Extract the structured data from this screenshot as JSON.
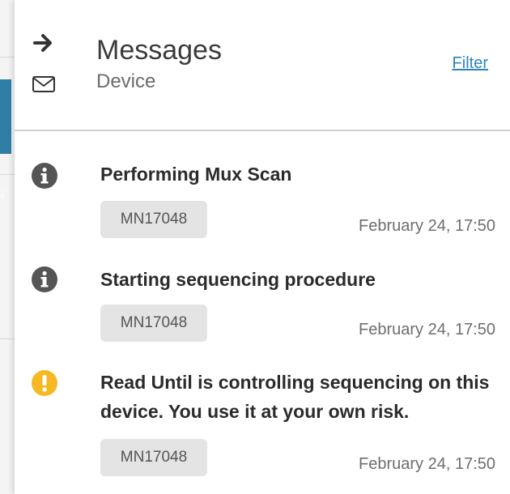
{
  "header": {
    "title": "Messages",
    "subtitle": "Device",
    "filter_label": "Filter"
  },
  "colors": {
    "info_icon": "#555555",
    "warning_icon": "#f4b923",
    "link": "#2a84b8",
    "badge_bg": "#e4e4e4"
  },
  "messages": [
    {
      "level": "info",
      "icon": "info-icon",
      "text": "Performing Mux Scan",
      "device": "MN17048",
      "time": "February 24, 17:50"
    },
    {
      "level": "info",
      "icon": "info-icon",
      "text": "Starting sequencing procedure",
      "device": "MN17048",
      "time": "February 24, 17:50"
    },
    {
      "level": "warning",
      "icon": "warning-icon",
      "text": "Read Until is controlling sequencing on this device. You use it at your own risk.",
      "device": "MN17048",
      "time": "February 24, 17:50"
    }
  ]
}
